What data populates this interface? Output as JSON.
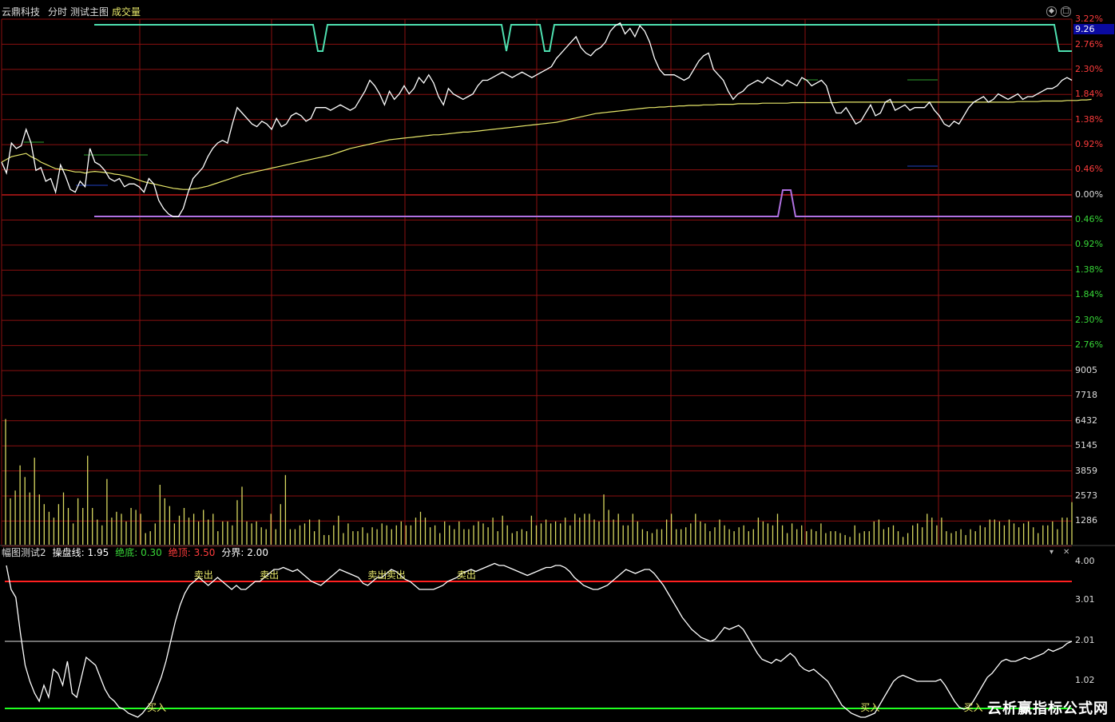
{
  "header": {
    "stock_name": "云鼎科技",
    "mode": "分时",
    "indicator": "测试主图",
    "volume_label": "成交量"
  },
  "price_axis": {
    "current_price": "9.26",
    "labels_up": [
      "3.22%",
      "2.76%",
      "2.30%",
      "1.84%",
      "1.38%",
      "0.92%",
      "0.46%"
    ],
    "zero_label": "0.00%",
    "labels_down": [
      "0.46%",
      "0.92%",
      "1.38%",
      "1.84%",
      "2.30%",
      "2.76%"
    ]
  },
  "volume_axis": {
    "labels": [
      "9005",
      "7718",
      "6432",
      "5145",
      "3859",
      "2573",
      "1286"
    ]
  },
  "sub_panel": {
    "name": "幅图测试2",
    "line_label": "操盘线: 1.95",
    "bottom_label": "绝底: 0.30",
    "top_label": "绝顶: 3.50",
    "divider_label": "分界: 2.00",
    "axis_labels": [
      "4.00",
      "3.01",
      "2.01",
      "1.02"
    ],
    "signals": [
      {
        "text": "卖出",
        "t": 42
      },
      {
        "text": "卖出",
        "t": 56
      },
      {
        "text": "卖出",
        "t": 79
      },
      {
        "text": "卖出",
        "t": 83
      },
      {
        "text": "卖出",
        "t": 98
      },
      {
        "text": "买入",
        "t": 32
      },
      {
        "text": "买入",
        "t": 184
      },
      {
        "text": "买入",
        "t": 206
      }
    ]
  },
  "watermark": "云析赢指标公式网",
  "colors": {
    "up": "#ff3c3c",
    "down": "#38d838",
    "price_line": "#ffffff",
    "avg_line": "#e8e86a",
    "cyan_line": "#4ee0b0",
    "purple_line": "#b070e0",
    "volume_bar": "#d8d860",
    "grid": "#8a1010",
    "grid_strong": "#c01818",
    "sub_top_line": "#ff2020",
    "sub_bottom_line": "#20ff20",
    "price_tag_bg": "#0a0aa0"
  },
  "chart_data": {
    "type": "line",
    "price_pct": [
      0.6,
      0.4,
      0.95,
      0.85,
      0.9,
      1.2,
      0.95,
      0.45,
      0.5,
      0.25,
      0.3,
      0.05,
      0.55,
      0.35,
      0.1,
      0.05,
      0.25,
      0.15,
      0.85,
      0.6,
      0.55,
      0.45,
      0.3,
      0.25,
      0.3,
      0.15,
      0.2,
      0.2,
      0.15,
      0.05,
      0.3,
      0.2,
      -0.1,
      -0.25,
      -0.35,
      -0.4,
      -0.4,
      -0.25,
      0.05,
      0.3,
      0.4,
      0.5,
      0.7,
      0.85,
      0.95,
      1.0,
      0.95,
      1.3,
      1.6,
      1.5,
      1.4,
      1.3,
      1.25,
      1.35,
      1.3,
      1.2,
      1.4,
      1.25,
      1.3,
      1.45,
      1.5,
      1.45,
      1.35,
      1.4,
      1.6,
      1.6,
      1.6,
      1.55,
      1.6,
      1.65,
      1.6,
      1.55,
      1.6,
      1.75,
      1.9,
      2.1,
      2.0,
      1.85,
      1.65,
      1.9,
      1.75,
      1.85,
      2.0,
      1.85,
      1.95,
      2.15,
      2.05,
      2.2,
      2.05,
      1.8,
      1.65,
      1.95,
      1.85,
      1.8,
      1.75,
      1.8,
      1.85,
      2.0,
      2.1,
      2.1,
      2.15,
      2.2,
      2.25,
      2.2,
      2.15,
      2.2,
      2.25,
      2.2,
      2.15,
      2.2,
      2.25,
      2.3,
      2.35,
      2.5,
      2.6,
      2.7,
      2.8,
      2.9,
      2.7,
      2.6,
      2.55,
      2.65,
      2.7,
      2.8,
      3.0,
      3.1,
      3.15,
      2.95,
      3.05,
      2.9,
      3.1,
      3.0,
      2.8,
      2.5,
      2.3,
      2.2,
      2.2,
      2.2,
      2.15,
      2.1,
      2.15,
      2.3,
      2.45,
      2.55,
      2.6,
      2.3,
      2.2,
      2.1,
      1.9,
      1.75,
      1.85,
      1.9,
      2.0,
      2.05,
      2.1,
      2.05,
      2.15,
      2.1,
      2.05,
      2.0,
      2.1,
      2.05,
      2.0,
      2.15,
      2.1,
      2.0,
      2.05,
      2.1,
      2.0,
      1.7,
      1.5,
      1.5,
      1.6,
      1.45,
      1.3,
      1.35,
      1.5,
      1.65,
      1.45,
      1.5,
      1.7,
      1.75,
      1.55,
      1.6,
      1.65,
      1.55,
      1.6,
      1.6,
      1.6,
      1.7,
      1.55,
      1.45,
      1.3,
      1.25,
      1.35,
      1.3,
      1.45,
      1.6,
      1.7,
      1.75,
      1.8,
      1.7,
      1.75,
      1.85,
      1.8,
      1.75,
      1.8,
      1.85,
      1.75,
      1.8,
      1.8,
      1.85,
      1.9,
      1.95,
      1.95,
      2.0,
      2.1,
      2.15,
      2.1
    ],
    "avg_pct": [
      0.6,
      0.65,
      0.7,
      0.72,
      0.74,
      0.76,
      0.7,
      0.66,
      0.6,
      0.56,
      0.52,
      0.48,
      0.47,
      0.46,
      0.44,
      0.42,
      0.42,
      0.4,
      0.42,
      0.43,
      0.42,
      0.41,
      0.4,
      0.38,
      0.37,
      0.35,
      0.33,
      0.3,
      0.27,
      0.24,
      0.22,
      0.2,
      0.18,
      0.16,
      0.14,
      0.12,
      0.11,
      0.1,
      0.1,
      0.11,
      0.12,
      0.14,
      0.16,
      0.19,
      0.22,
      0.25,
      0.28,
      0.31,
      0.34,
      0.37,
      0.39,
      0.41,
      0.43,
      0.45,
      0.47,
      0.49,
      0.51,
      0.53,
      0.55,
      0.57,
      0.59,
      0.61,
      0.63,
      0.65,
      0.67,
      0.69,
      0.71,
      0.73,
      0.76,
      0.79,
      0.82,
      0.85,
      0.87,
      0.89,
      0.91,
      0.93,
      0.95,
      0.97,
      0.99,
      1.01,
      1.02,
      1.03,
      1.04,
      1.05,
      1.06,
      1.07,
      1.08,
      1.09,
      1.1,
      1.1,
      1.11,
      1.12,
      1.13,
      1.14,
      1.15,
      1.15,
      1.16,
      1.17,
      1.18,
      1.19,
      1.2,
      1.21,
      1.22,
      1.23,
      1.24,
      1.25,
      1.26,
      1.27,
      1.28,
      1.29,
      1.3,
      1.31,
      1.32,
      1.33,
      1.35,
      1.37,
      1.39,
      1.41,
      1.43,
      1.45,
      1.47,
      1.49,
      1.5,
      1.51,
      1.52,
      1.53,
      1.54,
      1.55,
      1.56,
      1.57,
      1.58,
      1.59,
      1.6,
      1.6,
      1.61,
      1.61,
      1.62,
      1.62,
      1.63,
      1.63,
      1.64,
      1.64,
      1.64,
      1.65,
      1.65,
      1.65,
      1.66,
      1.66,
      1.66,
      1.66,
      1.67,
      1.67,
      1.67,
      1.67,
      1.67,
      1.68,
      1.68,
      1.68,
      1.68,
      1.68,
      1.68,
      1.69,
      1.69,
      1.69,
      1.69,
      1.69,
      1.69,
      1.69,
      1.69,
      1.69,
      1.69,
      1.7,
      1.7,
      1.7,
      1.7,
      1.7,
      1.7,
      1.7,
      1.7,
      1.7,
      1.7,
      1.7,
      1.7,
      1.7,
      1.7,
      1.7,
      1.7,
      1.7,
      1.7,
      1.7,
      1.7,
      1.7,
      1.7,
      1.7,
      1.7,
      1.7,
      1.7,
      1.7,
      1.7,
      1.7,
      1.7,
      1.7,
      1.7,
      1.7,
      1.7,
      1.7,
      1.7,
      1.71,
      1.71,
      1.71,
      1.71,
      1.71,
      1.72,
      1.72,
      1.72,
      1.72,
      1.72,
      1.73,
      1.73,
      1.73,
      1.74,
      1.74,
      1.75
    ],
    "volume": [
      6500,
      2400,
      2800,
      4100,
      3500,
      2700,
      4500,
      2600,
      2100,
      1700,
      1400,
      2100,
      2700,
      1900,
      1100,
      2400,
      1900,
      4600,
      1900,
      1300,
      1000,
      3400,
      1400,
      1700,
      1600,
      1200,
      1900,
      1800,
      1600,
      600,
      700,
      1100,
      3100,
      2400,
      2000,
      1100,
      1500,
      1900,
      1400,
      1600,
      1200,
      1800,
      1300,
      1600,
      700,
      1200,
      1200,
      1000,
      2300,
      3000,
      1200,
      1100,
      1200,
      900,
      800,
      1600,
      800,
      2100,
      3600,
      800,
      800,
      1000,
      1100,
      1300,
      700,
      1300,
      500,
      500,
      1000,
      1500,
      600,
      1100,
      700,
      700,
      900,
      600,
      900,
      800,
      1100,
      1000,
      800,
      1000,
      1200,
      1000,
      1000,
      1400,
      1700,
      1400,
      900,
      1000,
      600,
      1200,
      1000,
      800,
      1200,
      800,
      800,
      1000,
      1200,
      1100,
      900,
      1400,
      700,
      1500,
      1000,
      600,
      700,
      800,
      700,
      1500,
      1000,
      1100,
      1300,
      1100,
      1200,
      1100,
      1400,
      1000,
      1600,
      1400,
      1600,
      1600,
      1300,
      1200,
      2600,
      1800,
      1300,
      1600,
      1000,
      1000,
      1600,
      1200,
      800,
      700,
      600,
      800,
      800,
      1300,
      1600,
      800,
      800,
      900,
      1100,
      1600,
      1200,
      1100,
      700,
      900,
      1300,
      1000,
      800,
      700,
      900,
      1000,
      700,
      800,
      1400,
      1200,
      1100,
      1000,
      1600,
      1000,
      600,
      1100,
      800,
      1000,
      700,
      800,
      700,
      1100,
      600,
      700,
      700,
      600,
      500,
      400,
      1000,
      600,
      700,
      700,
      1200,
      1300,
      800,
      900,
      1000,
      700,
      400,
      600,
      1000,
      1100,
      900,
      1600,
      1400,
      1000,
      1400,
      700,
      600,
      700,
      800,
      500,
      800,
      700,
      1000,
      900,
      1300,
      1300,
      1200,
      1000,
      1300,
      1100,
      900,
      1100,
      1200,
      900,
      600,
      1000,
      1000,
      1200,
      800,
      1400,
      1400,
      2200
    ],
    "sub_line": [
      3.9,
      3.3,
      3.1,
      2.2,
      1.4,
      1.0,
      0.7,
      0.5,
      0.9,
      0.6,
      1.3,
      1.2,
      0.9,
      1.5,
      0.7,
      0.6,
      1.1,
      1.6,
      1.5,
      1.4,
      1.1,
      0.8,
      0.6,
      0.5,
      0.35,
      0.3,
      0.2,
      0.15,
      0.1,
      0.2,
      0.35,
      0.5,
      0.8,
      1.1,
      1.5,
      2.0,
      2.5,
      2.9,
      3.2,
      3.4,
      3.5,
      3.6,
      3.5,
      3.4,
      3.5,
      3.6,
      3.5,
      3.4,
      3.3,
      3.4,
      3.3,
      3.3,
      3.4,
      3.5,
      3.5,
      3.6,
      3.7,
      3.8,
      3.8,
      3.85,
      3.8,
      3.75,
      3.8,
      3.7,
      3.6,
      3.5,
      3.45,
      3.4,
      3.5,
      3.6,
      3.7,
      3.8,
      3.75,
      3.7,
      3.65,
      3.6,
      3.45,
      3.4,
      3.5,
      3.6,
      3.6,
      3.7,
      3.8,
      3.75,
      3.65,
      3.55,
      3.5,
      3.4,
      3.3,
      3.3,
      3.3,
      3.3,
      3.35,
      3.4,
      3.5,
      3.55,
      3.6,
      3.7,
      3.75,
      3.8,
      3.75,
      3.8,
      3.85,
      3.9,
      3.95,
      3.9,
      3.9,
      3.85,
      3.8,
      3.75,
      3.7,
      3.65,
      3.7,
      3.75,
      3.8,
      3.85,
      3.85,
      3.9,
      3.9,
      3.85,
      3.75,
      3.6,
      3.5,
      3.4,
      3.35,
      3.3,
      3.3,
      3.35,
      3.4,
      3.5,
      3.6,
      3.7,
      3.8,
      3.75,
      3.7,
      3.75,
      3.8,
      3.8,
      3.7,
      3.55,
      3.4,
      3.2,
      3.0,
      2.8,
      2.6,
      2.45,
      2.3,
      2.2,
      2.1,
      2.05,
      2.0,
      2.05,
      2.2,
      2.35,
      2.3,
      2.35,
      2.4,
      2.3,
      2.1,
      1.9,
      1.7,
      1.55,
      1.5,
      1.45,
      1.55,
      1.5,
      1.6,
      1.7,
      1.6,
      1.4,
      1.3,
      1.25,
      1.3,
      1.2,
      1.1,
      1.0,
      0.8,
      0.6,
      0.4,
      0.3,
      0.2,
      0.15,
      0.1,
      0.1,
      0.15,
      0.2,
      0.4,
      0.6,
      0.8,
      1.0,
      1.1,
      1.15,
      1.1,
      1.05,
      1.0,
      1.0,
      1.0,
      1.0,
      1.0,
      1.05,
      0.9,
      0.7,
      0.5,
      0.35,
      0.3,
      0.35,
      0.5,
      0.7,
      0.9,
      1.1,
      1.2,
      1.35,
      1.5,
      1.55,
      1.5,
      1.5,
      1.55,
      1.6,
      1.55,
      1.6,
      1.65,
      1.7,
      1.8,
      1.75,
      1.8,
      1.85,
      1.95,
      2.0
    ]
  }
}
